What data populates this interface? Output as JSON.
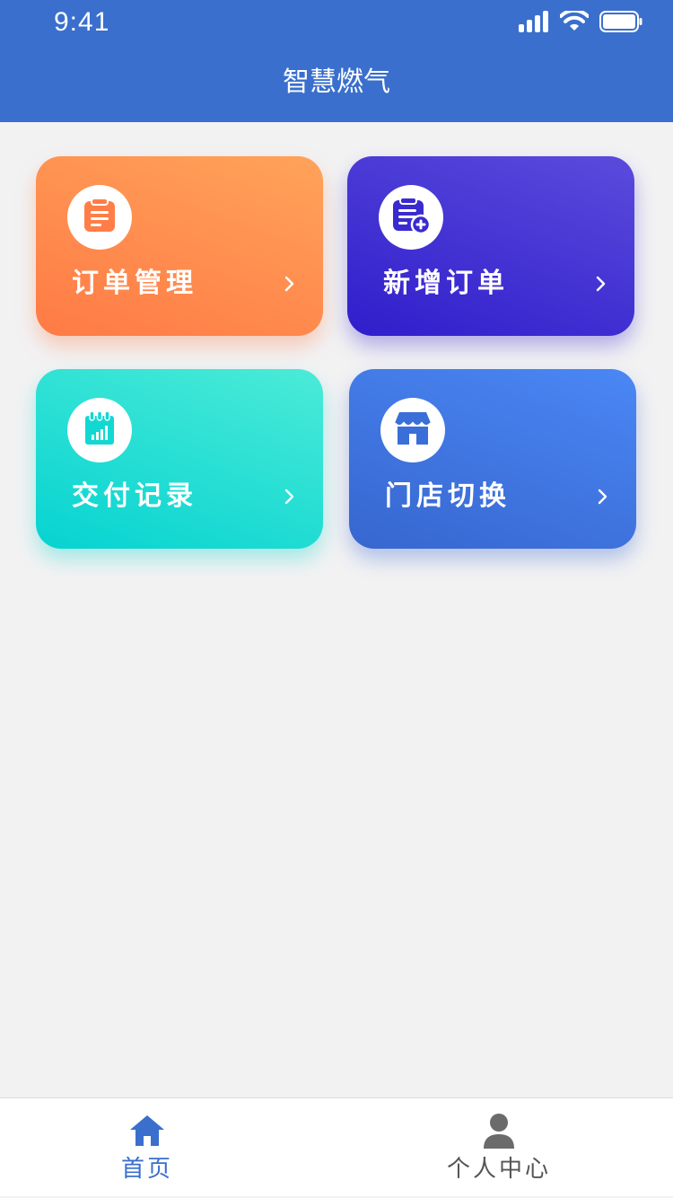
{
  "status_bar": {
    "time": "9:41"
  },
  "header": {
    "title": "智慧燃气"
  },
  "cards": [
    {
      "label": "订单管理",
      "icon": "clipboard-icon",
      "color": "#ff8a4e"
    },
    {
      "label": "新增订单",
      "icon": "add-order-icon",
      "color": "#3f2fd2"
    },
    {
      "label": "交付记录",
      "icon": "delivery-record-icon",
      "color": "#1fdcd4"
    },
    {
      "label": "门店切换",
      "icon": "store-icon",
      "color": "#3f76e0"
    }
  ],
  "tabbar": {
    "items": [
      {
        "label": "首页",
        "icon": "home-icon",
        "active": true
      },
      {
        "label": "个人中心",
        "icon": "user-icon",
        "active": false
      }
    ],
    "active_color": "#3a6fcd"
  },
  "colors": {
    "header": "#3a6fcd",
    "background": "#f2f2f3"
  }
}
